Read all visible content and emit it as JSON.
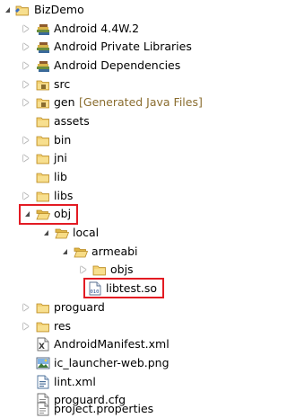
{
  "tree": {
    "items": [
      {
        "label": "BizDemo",
        "decoration": "",
        "icon": "project-folder-icon",
        "state": "expanded"
      },
      {
        "label": "Android 4.4W.2",
        "decoration": "",
        "icon": "library-books-icon",
        "state": "collapsed"
      },
      {
        "label": "Android Private Libraries",
        "decoration": "",
        "icon": "library-books-icon",
        "state": "collapsed"
      },
      {
        "label": "Android Dependencies",
        "decoration": "",
        "icon": "library-books-icon",
        "state": "collapsed"
      },
      {
        "label": "src",
        "decoration": "",
        "icon": "source-folder-icon",
        "state": "collapsed"
      },
      {
        "label": "gen",
        "decoration": "[Generated Java Files]",
        "icon": "source-folder-icon",
        "state": "collapsed"
      },
      {
        "label": "assets",
        "decoration": "",
        "icon": "folder-icon",
        "state": "none"
      },
      {
        "label": "bin",
        "decoration": "",
        "icon": "folder-icon",
        "state": "collapsed"
      },
      {
        "label": "jni",
        "decoration": "",
        "icon": "folder-icon",
        "state": "collapsed"
      },
      {
        "label": "lib",
        "decoration": "",
        "icon": "folder-icon",
        "state": "none"
      },
      {
        "label": "libs",
        "decoration": "",
        "icon": "folder-icon",
        "state": "collapsed"
      },
      {
        "label": "obj",
        "decoration": "",
        "icon": "folder-open-icon",
        "state": "expanded"
      },
      {
        "label": "local",
        "decoration": "",
        "icon": "folder-open-icon",
        "state": "expanded"
      },
      {
        "label": "armeabi",
        "decoration": "",
        "icon": "folder-open-icon",
        "state": "expanded"
      },
      {
        "label": "objs",
        "decoration": "",
        "icon": "folder-icon",
        "state": "collapsed"
      },
      {
        "label": "libtest.so",
        "decoration": "",
        "icon": "binary-file-icon",
        "state": "none"
      },
      {
        "label": "proguard",
        "decoration": "",
        "icon": "folder-icon",
        "state": "collapsed"
      },
      {
        "label": "res",
        "decoration": "",
        "icon": "folder-icon",
        "state": "collapsed"
      },
      {
        "label": "AndroidManifest.xml",
        "decoration": "",
        "icon": "android-manifest-icon",
        "state": "none"
      },
      {
        "label": "ic_launcher-web.png",
        "decoration": "",
        "icon": "image-file-icon",
        "state": "none"
      },
      {
        "label": "lint.xml",
        "decoration": "",
        "icon": "xml-file-icon",
        "state": "none"
      },
      {
        "label": "proguard.cfg",
        "decoration": "",
        "icon": "text-file-icon",
        "state": "none"
      },
      {
        "label": "project.properties",
        "decoration": "",
        "icon": "text-file-icon",
        "state": "none"
      }
    ]
  },
  "colors": {
    "highlight": "#e31b23",
    "decoration_text": "#8a6d2f",
    "folder": "#e8c15a",
    "folder_dark": "#c9982b",
    "library": "#4f7f3a"
  }
}
